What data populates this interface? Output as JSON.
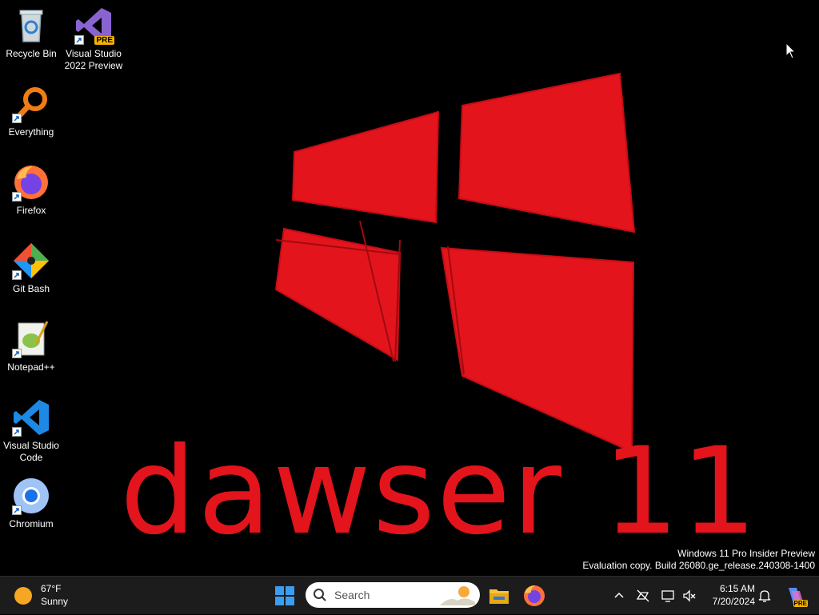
{
  "desktop": {
    "wallpaper_text": "dawser 11",
    "accent_color": "#e3141c",
    "icons": [
      {
        "label": "Recycle Bin",
        "icon": "recycle-bin-icon"
      },
      {
        "label": "Visual Studio 2022 Preview",
        "icon": "visual-studio-icon",
        "badge": "PRE"
      },
      {
        "label": "Everything",
        "icon": "everything-search-icon"
      },
      {
        "label": "Firefox",
        "icon": "firefox-icon"
      },
      {
        "label": "Git Bash",
        "icon": "git-bash-icon"
      },
      {
        "label": "Notepad++",
        "icon": "notepad-plus-plus-icon"
      },
      {
        "label": "Visual Studio Code",
        "icon": "vscode-icon"
      },
      {
        "label": "Chromium",
        "icon": "chromium-icon"
      }
    ]
  },
  "watermark": {
    "line1": "Windows 11 Pro Insider Preview",
    "line2": "Evaluation copy. Build 26080.ge_release.240308-1400"
  },
  "taskbar": {
    "weather": {
      "temp": "67°F",
      "condition": "Sunny"
    },
    "search": {
      "placeholder": "Search"
    },
    "apps": [
      "file-explorer-icon",
      "firefox-icon"
    ],
    "tray": [
      "chevron-up-icon",
      "network-disconnected-icon",
      "display-icon",
      "volume-muted-icon"
    ],
    "clock": {
      "time": "6:15 AM",
      "date": "7/20/2024"
    },
    "copilot_badge": "PRE"
  }
}
